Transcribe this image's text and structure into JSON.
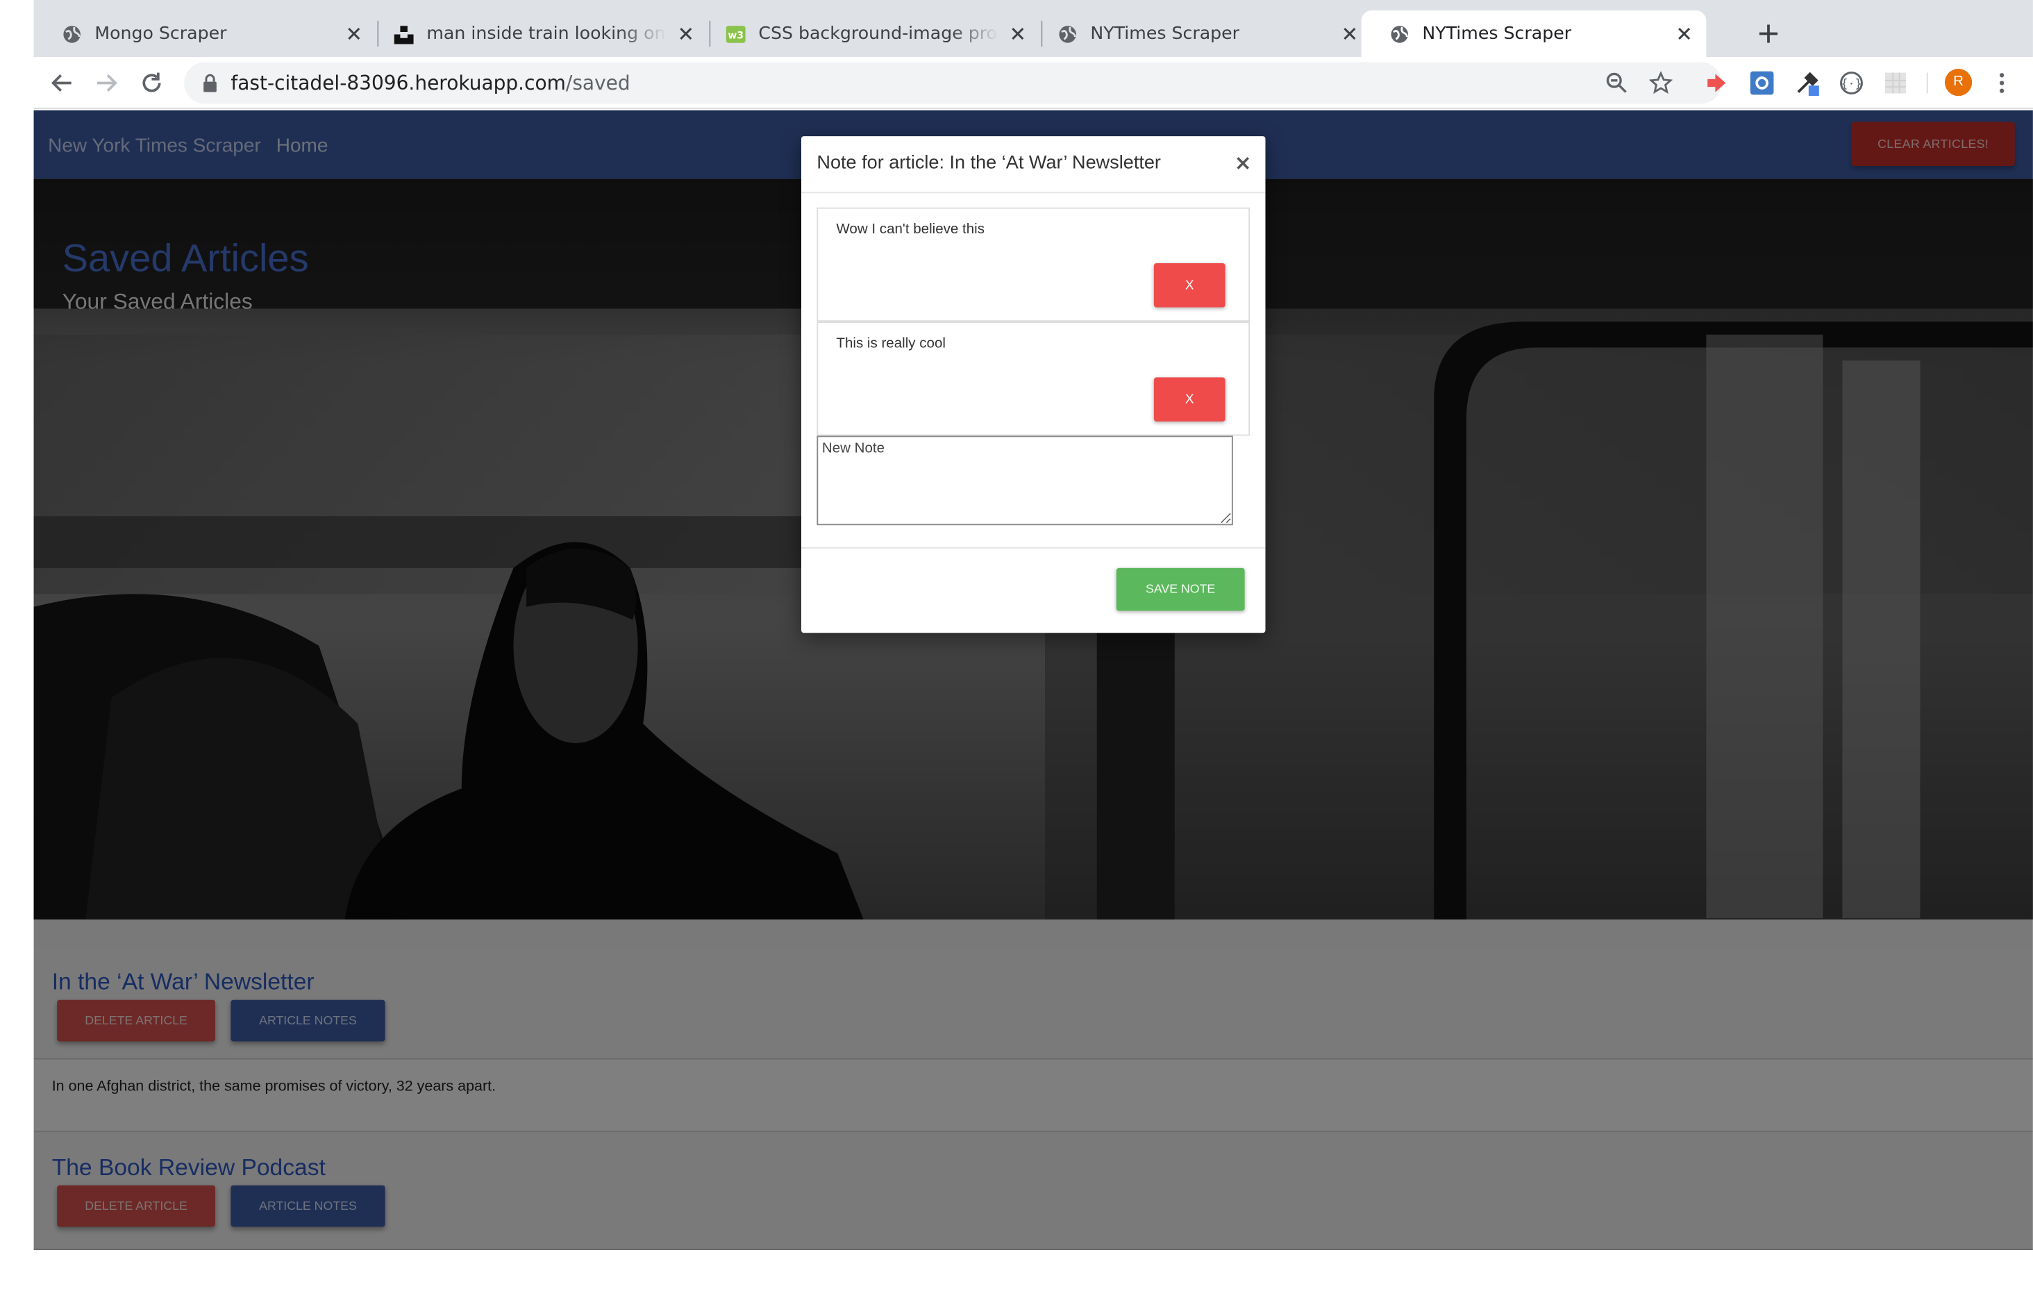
{
  "browser": {
    "tabs": [
      {
        "title": "Mongo Scraper",
        "favicon": "globe-icon"
      },
      {
        "title": "man inside train looking on window",
        "favicon": "unsplash-icon"
      },
      {
        "title": "CSS background-image property",
        "favicon": "w3schools-icon"
      },
      {
        "title": "NYTimes Scraper",
        "favicon": "globe-icon"
      },
      {
        "title": "NYTimes Scraper",
        "favicon": "globe-icon"
      }
    ],
    "active_tab": 4,
    "url_host": "fast-citadel-83096.herokuapp.com",
    "url_path": "/saved",
    "avatar_letter": "R"
  },
  "navbar": {
    "brand": "New York Times Scraper",
    "home": "Home",
    "clear_label": "Clear Articles!",
    "color": "#3f5ea8"
  },
  "hero": {
    "title": "Saved Articles",
    "subtitle": "Your Saved Articles"
  },
  "articles": [
    {
      "title": "In the ‘At War’ Newsletter",
      "delete_label": "Delete Article",
      "notes_label": "Article Notes",
      "summary": "In one Afghan district, the same promises of victory, 32 years apart."
    },
    {
      "title": "The Book Review Podcast",
      "delete_label": "Delete Article",
      "notes_label": "Article Notes"
    }
  ],
  "modal": {
    "title": "Note for article: In the ‘At War’ Newsletter",
    "close": "×",
    "notes": [
      {
        "text": "Wow I can't believe this",
        "delete_label": "X"
      },
      {
        "text": "This is really cool",
        "delete_label": "X"
      }
    ],
    "new_note_placeholder": "New Note",
    "save_label": "Save Note"
  },
  "colors": {
    "danger": "#d9534f",
    "primary": "#3f5ea8",
    "success": "#5cb85c",
    "note_delete": "#ef4b4b"
  }
}
